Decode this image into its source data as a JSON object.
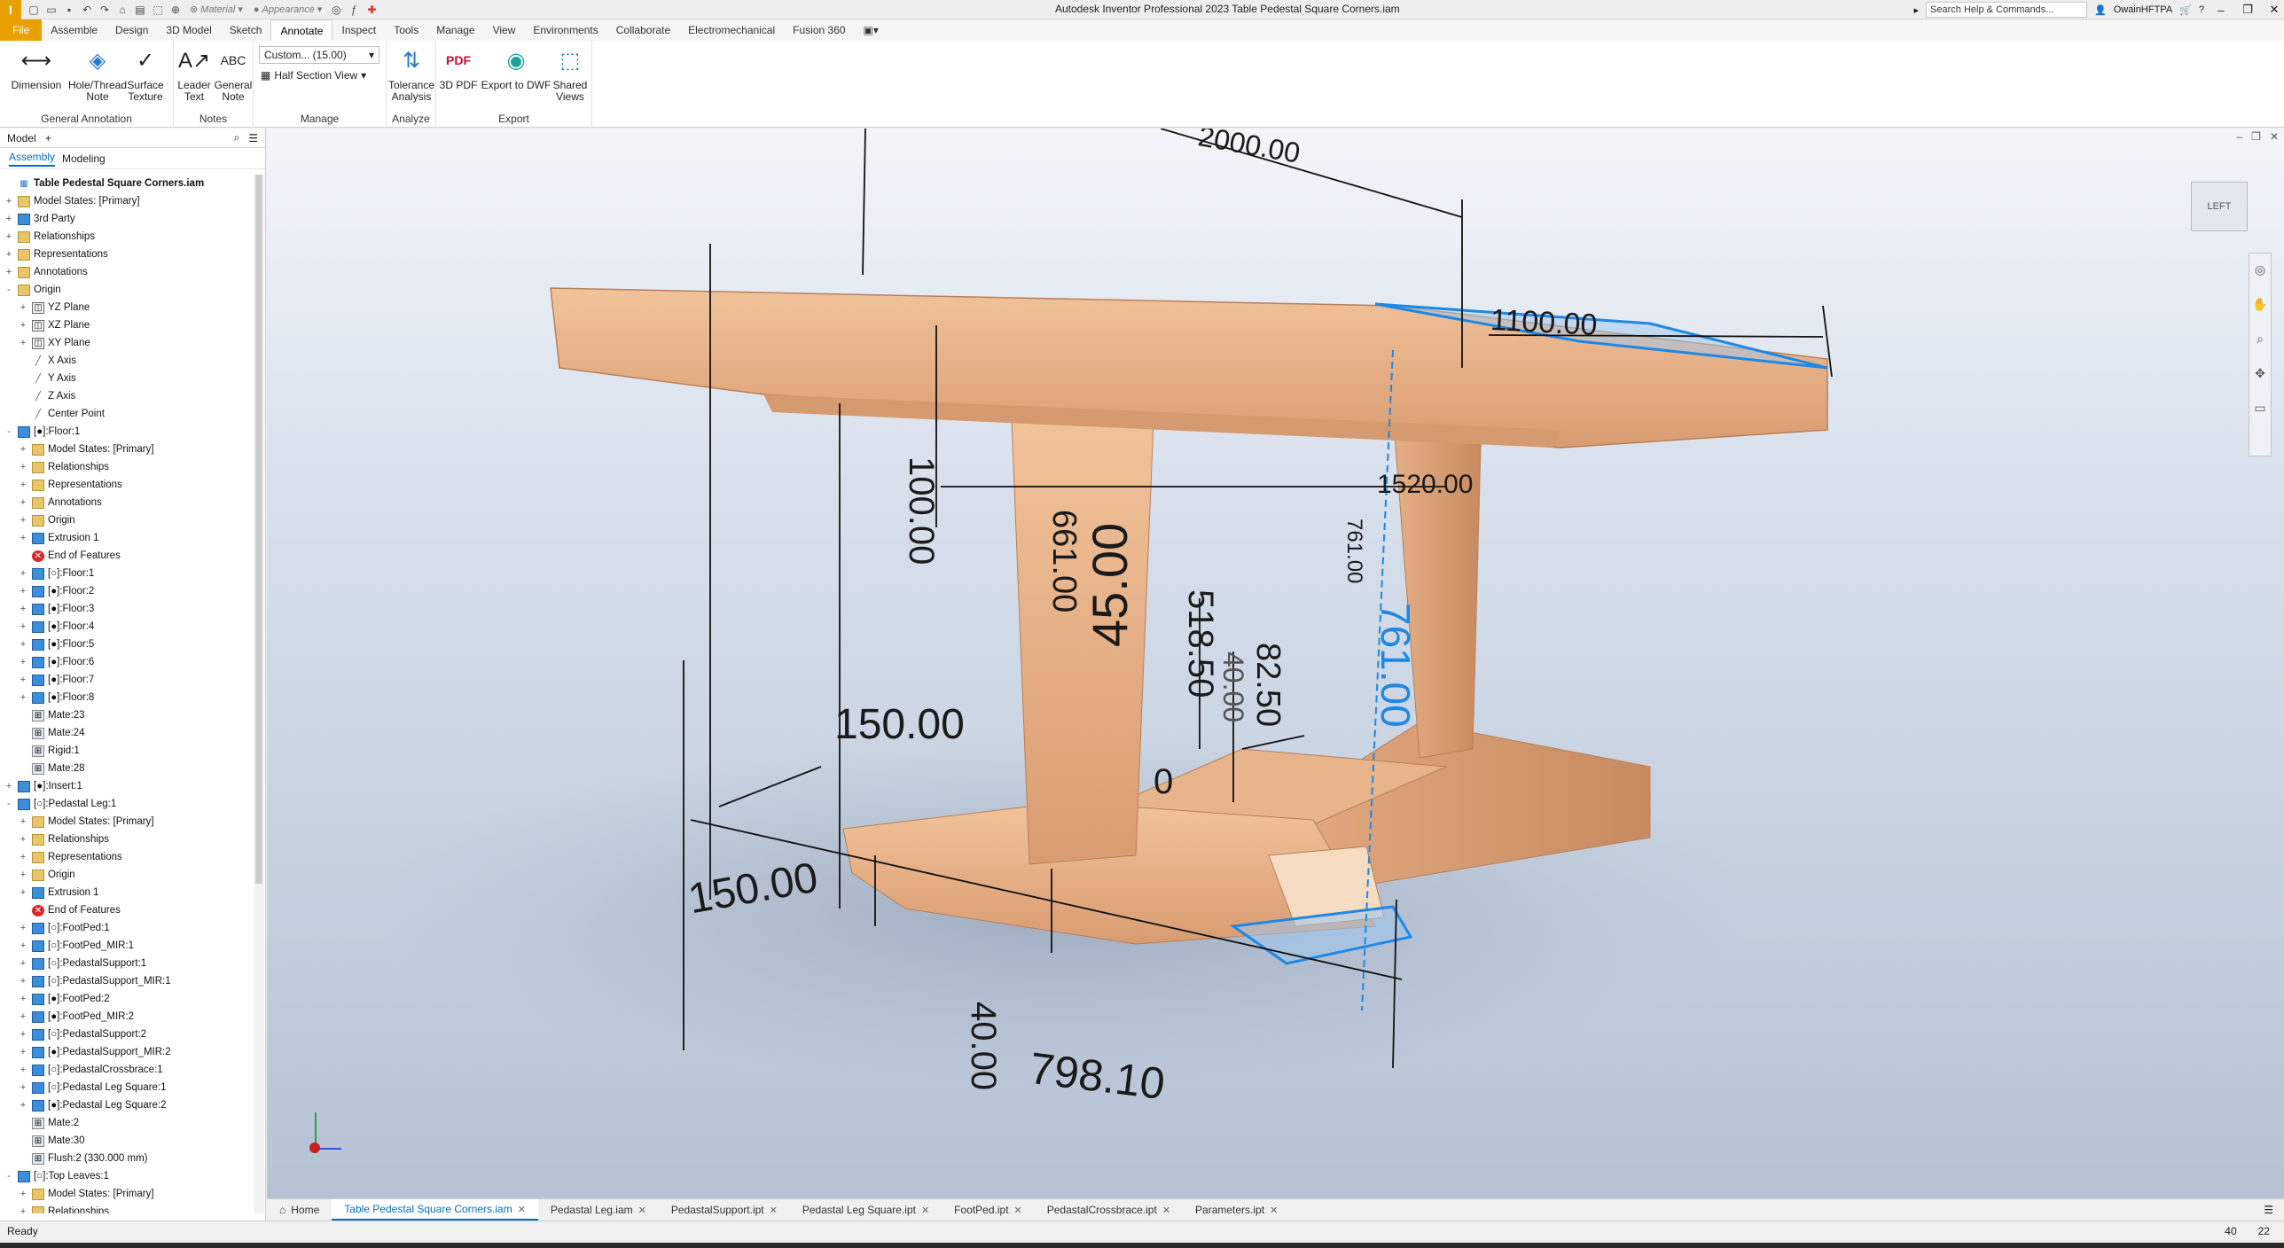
{
  "app": {
    "window_title": "Autodesk Inventor Professional 2023   Table Pedestal Square Corners.iam",
    "logo": "I",
    "search_placeholder": "Search Help & Commands...",
    "user": "OwainHFTPA",
    "quick_access": {
      "material": "Material",
      "appearance": "Appearance"
    }
  },
  "menu_tabs": [
    "File",
    "Assemble",
    "Design",
    "3D Model",
    "Sketch",
    "Annotate",
    "Inspect",
    "Tools",
    "Manage",
    "View",
    "Environments",
    "Collaborate",
    "Electromechanical",
    "Fusion 360"
  ],
  "active_tab": "Annotate",
  "ribbon": {
    "general_annotation": {
      "label": "General Annotation",
      "buttons": [
        "Dimension",
        "Hole/Thread Note",
        "Surface Texture"
      ]
    },
    "notes": {
      "label": "Notes",
      "buttons": [
        "Leader Text",
        "General Note"
      ]
    },
    "manage": {
      "label": "Manage",
      "scale_combo": "Custom... (15.00)",
      "section_view": "Half Section View"
    },
    "analyze": {
      "label": "Analyze",
      "buttons": [
        "Tolerance Analysis"
      ]
    },
    "export": {
      "label": "Export",
      "buttons": [
        "3D PDF",
        "Export to DWF",
        "Shared Views"
      ]
    }
  },
  "browser": {
    "title": "Model",
    "tabs": [
      "Assembly",
      "Modeling"
    ],
    "tree": [
      {
        "level": 0,
        "exp": "",
        "icon": "asm",
        "label": "Table Pedestal Square Corners.iam",
        "bold": true
      },
      {
        "level": 0,
        "exp": "+",
        "icon": "folder",
        "label": "Model States: [Primary]"
      },
      {
        "level": 0,
        "exp": "+",
        "icon": "part",
        "label": "3rd Party"
      },
      {
        "level": 0,
        "exp": "+",
        "icon": "folder",
        "label": "Relationships"
      },
      {
        "level": 0,
        "exp": "+",
        "icon": "folder",
        "label": "Representations"
      },
      {
        "level": 0,
        "exp": "+",
        "icon": "folder",
        "label": "Annotations"
      },
      {
        "level": 0,
        "exp": "-",
        "icon": "folder",
        "label": "Origin"
      },
      {
        "level": 1,
        "exp": "+",
        "icon": "plane",
        "label": "YZ Plane"
      },
      {
        "level": 1,
        "exp": "+",
        "icon": "plane",
        "label": "XZ Plane"
      },
      {
        "level": 1,
        "exp": "+",
        "icon": "plane",
        "label": "XY Plane"
      },
      {
        "level": 1,
        "exp": "",
        "icon": "axis",
        "label": "X Axis"
      },
      {
        "level": 1,
        "exp": "",
        "icon": "axis",
        "label": "Y Axis"
      },
      {
        "level": 1,
        "exp": "",
        "icon": "axis",
        "label": "Z Axis"
      },
      {
        "level": 1,
        "exp": "",
        "icon": "axis",
        "label": "Center Point"
      },
      {
        "level": 0,
        "exp": "-",
        "icon": "part",
        "label": "[●]:Floor:1"
      },
      {
        "level": 1,
        "exp": "+",
        "icon": "folder",
        "label": "Model States: [Primary]"
      },
      {
        "level": 1,
        "exp": "+",
        "icon": "folder",
        "label": "Relationships"
      },
      {
        "level": 1,
        "exp": "+",
        "icon": "folder",
        "label": "Representations"
      },
      {
        "level": 1,
        "exp": "+",
        "icon": "folder",
        "label": "Annotations"
      },
      {
        "level": 1,
        "exp": "+",
        "icon": "folder",
        "label": "Origin"
      },
      {
        "level": 1,
        "exp": "+",
        "icon": "part",
        "label": "Extrusion 1"
      },
      {
        "level": 1,
        "exp": "",
        "icon": "err",
        "label": "End of Features"
      },
      {
        "level": 1,
        "exp": "+",
        "icon": "part",
        "label": "[○]:Floor:1"
      },
      {
        "level": 1,
        "exp": "+",
        "icon": "part",
        "label": "[●]:Floor:2"
      },
      {
        "level": 1,
        "exp": "+",
        "icon": "part",
        "label": "[●]:Floor:3"
      },
      {
        "level": 1,
        "exp": "+",
        "icon": "part",
        "label": "[●]:Floor:4"
      },
      {
        "level": 1,
        "exp": "+",
        "icon": "part",
        "label": "[●]:Floor:5"
      },
      {
        "level": 1,
        "exp": "+",
        "icon": "part",
        "label": "[●]:Floor:6"
      },
      {
        "level": 1,
        "exp": "+",
        "icon": "part",
        "label": "[●]:Floor:7"
      },
      {
        "level": 1,
        "exp": "+",
        "icon": "part",
        "label": "[●]:Floor:8"
      },
      {
        "level": 1,
        "exp": "",
        "icon": "mate",
        "label": "Mate:23"
      },
      {
        "level": 1,
        "exp": "",
        "icon": "mate",
        "label": "Mate:24"
      },
      {
        "level": 1,
        "exp": "",
        "icon": "mate",
        "label": "Rigid:1"
      },
      {
        "level": 1,
        "exp": "",
        "icon": "mate",
        "label": "Mate:28"
      },
      {
        "level": 0,
        "exp": "+",
        "icon": "part",
        "label": "[●]:Insert:1"
      },
      {
        "level": 0,
        "exp": "-",
        "icon": "part",
        "label": "[○]:Pedastal Leg:1"
      },
      {
        "level": 1,
        "exp": "+",
        "icon": "folder",
        "label": "Model States: [Primary]"
      },
      {
        "level": 1,
        "exp": "+",
        "icon": "folder",
        "label": "Relationships"
      },
      {
        "level": 1,
        "exp": "+",
        "icon": "folder",
        "label": "Representations"
      },
      {
        "level": 1,
        "exp": "+",
        "icon": "folder",
        "label": "Origin"
      },
      {
        "level": 1,
        "exp": "+",
        "icon": "part",
        "label": "Extrusion 1"
      },
      {
        "level": 1,
        "exp": "",
        "icon": "err",
        "label": "End of Features"
      },
      {
        "level": 1,
        "exp": "+",
        "icon": "part",
        "label": "[○]:FootPed:1"
      },
      {
        "level": 1,
        "exp": "+",
        "icon": "part",
        "label": "[○]:FootPed_MIR:1"
      },
      {
        "level": 1,
        "exp": "+",
        "icon": "part",
        "label": "[○]:PedastalSupport:1"
      },
      {
        "level": 1,
        "exp": "+",
        "icon": "part",
        "label": "[○]:PedastalSupport_MIR:1"
      },
      {
        "level": 1,
        "exp": "+",
        "icon": "part",
        "label": "[●]:FootPed:2"
      },
      {
        "level": 1,
        "exp": "+",
        "icon": "part",
        "label": "[●]:FootPed_MIR:2"
      },
      {
        "level": 1,
        "exp": "+",
        "icon": "part",
        "label": "[○]:PedastalSupport:2"
      },
      {
        "level": 1,
        "exp": "+",
        "icon": "part",
        "label": "[●]:PedastalSupport_MIR:2"
      },
      {
        "level": 1,
        "exp": "+",
        "icon": "part",
        "label": "[○]:PedastalCrossbrace:1"
      },
      {
        "level": 1,
        "exp": "+",
        "icon": "part",
        "label": "[○]:Pedastal Leg Square:1"
      },
      {
        "level": 1,
        "exp": "+",
        "icon": "part",
        "label": "[●]:Pedastal Leg Square:2"
      },
      {
        "level": 1,
        "exp": "",
        "icon": "mate",
        "label": "Mate:2"
      },
      {
        "level": 1,
        "exp": "",
        "icon": "mate",
        "label": "Mate:30"
      },
      {
        "level": 1,
        "exp": "",
        "icon": "mate",
        "label": "Flush:2 (330.000 mm)"
      },
      {
        "level": 0,
        "exp": "-",
        "icon": "part",
        "label": "[○]:Top Leaves:1"
      },
      {
        "level": 1,
        "exp": "+",
        "icon": "folder",
        "label": "Model States: [Primary]"
      },
      {
        "level": 1,
        "exp": "+",
        "icon": "folder",
        "label": "Relationships"
      }
    ]
  },
  "viewport": {
    "viewcube_label": "LEFT",
    "dimensions": [
      "2000.00",
      "1100.00",
      "1520.00",
      "100.00",
      "661.00",
      "45.00",
      "518.50",
      "82.50",
      "40.00",
      "761.00",
      "761.00",
      "150.00",
      "150.00",
      "40.00",
      "798.10",
      "0"
    ]
  },
  "doc_tabs": {
    "home": "Home",
    "tabs": [
      "Table Pedestal Square Corners.iam",
      "Pedastal Leg.iam",
      "PedastalSupport.ipt",
      "Pedastal Leg Square.ipt",
      "FootPed.ipt",
      "PedastalCrossbrace.ipt",
      "Parameters.ipt"
    ],
    "active": 0
  },
  "status": {
    "text": "Ready",
    "count_a": "40",
    "count_b": "22"
  },
  "colors": {
    "accent": "#0070c0",
    "file_tab": "#e8a000",
    "wood": "#e9b58b",
    "selection": "#1e88e5"
  }
}
